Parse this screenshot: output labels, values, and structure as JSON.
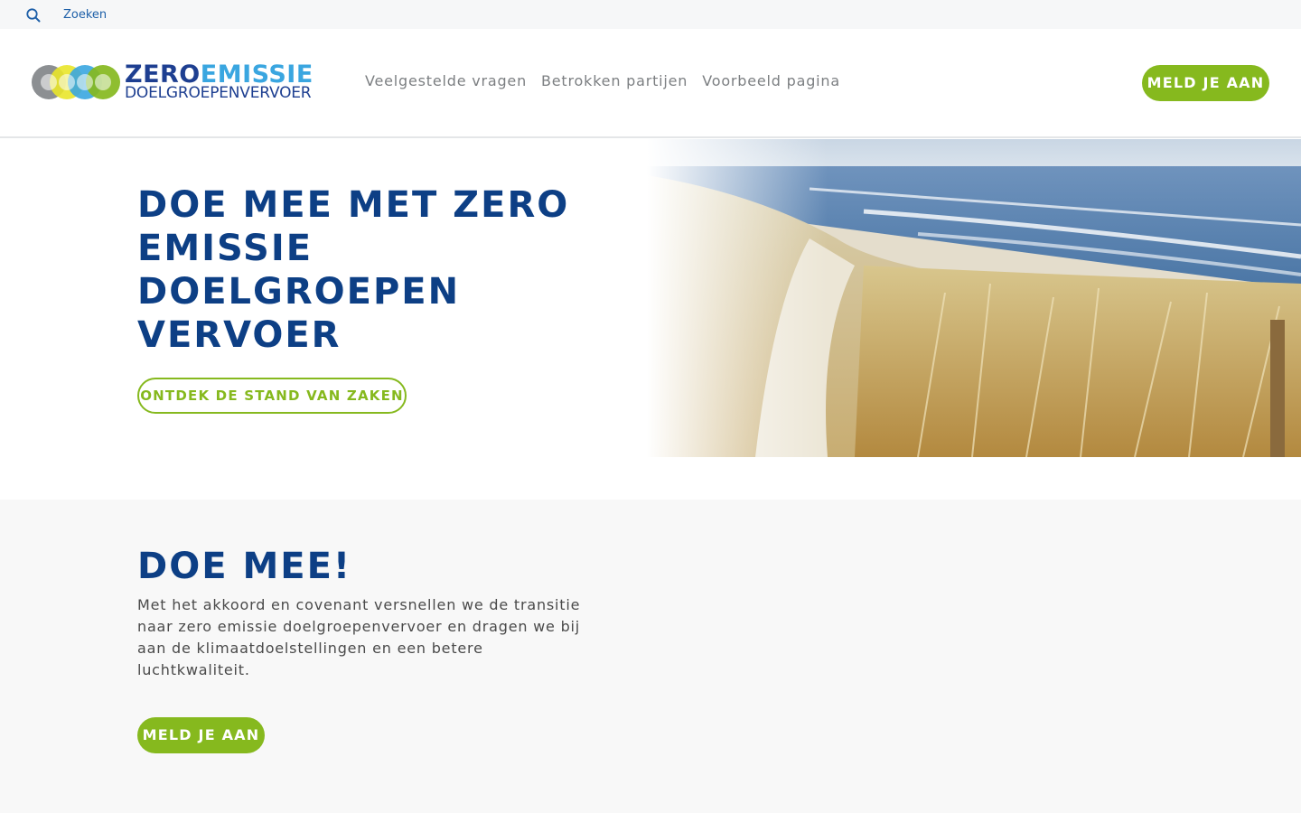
{
  "topbar": {
    "search_icon": "search-icon",
    "search_label": "Zoeken"
  },
  "header": {
    "logo": {
      "line1_a": "ZERO",
      "line1_b": "EMISSIE",
      "line2": "DOELGROEPENVERVOER"
    },
    "nav": [
      {
        "label": "Veelgestelde vragen"
      },
      {
        "label": "Betrokken partijen"
      },
      {
        "label": "Voorbeeld pagina"
      }
    ],
    "cta_label": "MELD JE AAN"
  },
  "hero": {
    "title": "DOE MEE MET ZERO EMISSIE DOELGROEPEN VERVOER",
    "button_label": "ONTDEK DE STAND VAN ZAKEN",
    "image": "beach-dunes-photo"
  },
  "section": {
    "title": "DOE MEE!",
    "text": "Met het akkoord en covenant versnellen we de transitie naar zero emissie doelgroepenvervoer en dragen we bij aan de klimaatdoelstellingen en een betere luchtkwaliteit.",
    "button_label": "MELD JE AAN"
  },
  "colors": {
    "brand_blue": "#0d3f85",
    "accent_green": "#86b91e",
    "link_blue": "#1d5fa8",
    "logo_light_blue": "#3aa6e0"
  }
}
